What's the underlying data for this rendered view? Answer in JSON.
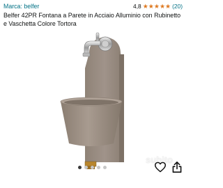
{
  "header": {
    "brand_label": "Marca: belfer",
    "rating_value": "4,8",
    "stars": 5,
    "review_count": "(20)",
    "star_color": "#de7921",
    "link_color": "#007185"
  },
  "product": {
    "title": "Belfer 42PR Fontana a Parete in Acciaio Alluminio con Rubinetto e Vaschetta Colore Tortora",
    "body_color": "#998c7f",
    "watermark": "subito"
  },
  "gallery": {
    "current_image": 1,
    "total_images": 5
  },
  "actions": {
    "favorite_icon": "heart-icon",
    "share_icon": "share-icon"
  }
}
